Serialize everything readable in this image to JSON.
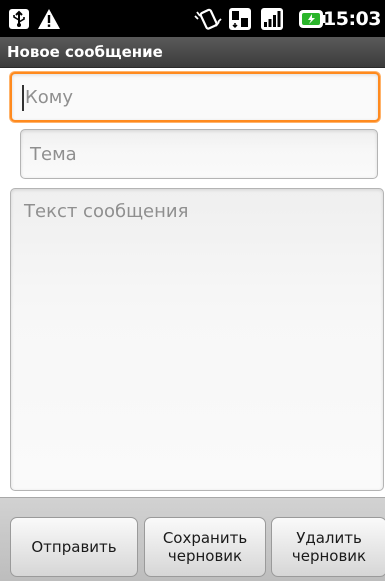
{
  "status_bar": {
    "time": "15:03",
    "icons": [
      "usb-icon",
      "warning-icon",
      "vibrate-icon",
      "data-3g-icon",
      "signal-icon",
      "battery-charging-icon"
    ]
  },
  "title_bar": {
    "title": "Новое сообщение"
  },
  "compose": {
    "to_placeholder": "Кому",
    "subject_placeholder": "Тема",
    "body_placeholder": "Текст сообщения"
  },
  "buttons": {
    "send": "Отправить",
    "save_draft": "Сохранить\nчерновик",
    "delete_draft": "Удалить\nчерновик"
  },
  "colors": {
    "focus_accent": "#ff8a1e",
    "status_bar": "#000000",
    "title_bar": "#4a4a4a"
  }
}
